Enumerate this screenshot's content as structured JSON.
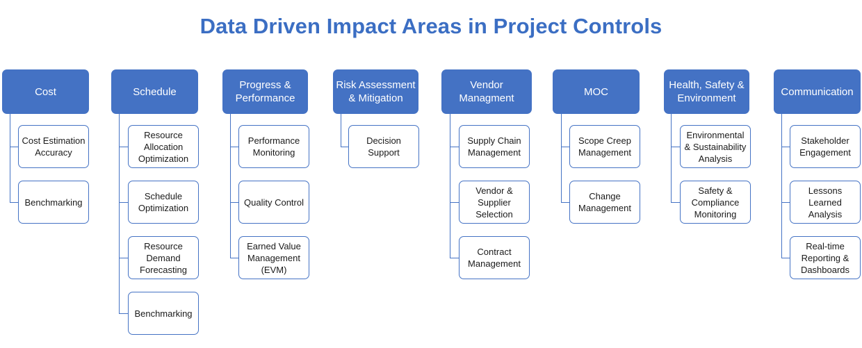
{
  "title": "Data Driven Impact Areas in Project Controls",
  "theme": {
    "header_fill": "#4472C4",
    "header_text": "#FFFFFF",
    "child_border": "#4472C4",
    "child_fill": "#FFFFFF",
    "child_text": "#1A1A1A",
    "title_color": "#3B6EC3",
    "connector_color": "#4472C4",
    "background": "#FFFFFF"
  },
  "columns": [
    {
      "header": "Cost",
      "children": [
        "Cost Estimation Accuracy",
        "Benchmarking"
      ]
    },
    {
      "header": "Schedule",
      "children": [
        "Resource Allocation Optimization",
        "Schedule Optimization",
        "Resource Demand Forecasting",
        "Benchmarking"
      ]
    },
    {
      "header": "Progress & Performance",
      "children": [
        "Performance Monitoring",
        "Quality Control",
        "Earned Value Management (EVM)"
      ]
    },
    {
      "header": "Risk Assessment & Mitigation",
      "children": [
        "Decision Support"
      ]
    },
    {
      "header": "Vendor Managment",
      "children": [
        "Supply Chain Management",
        "Vendor & Supplier Selection",
        "Contract Management"
      ]
    },
    {
      "header": "MOC",
      "children": [
        "Scope Creep Management",
        "Change Management"
      ]
    },
    {
      "header": "Health, Safety & Environment",
      "children": [
        "Environmental & Sustainability Analysis",
        "Safety & Compliance Monitoring"
      ]
    },
    {
      "header": "Communication",
      "children": [
        "Stakeholder Engagement",
        "Lessons Learned Analysis",
        "Real-time Reporting & Dashboards"
      ]
    }
  ]
}
